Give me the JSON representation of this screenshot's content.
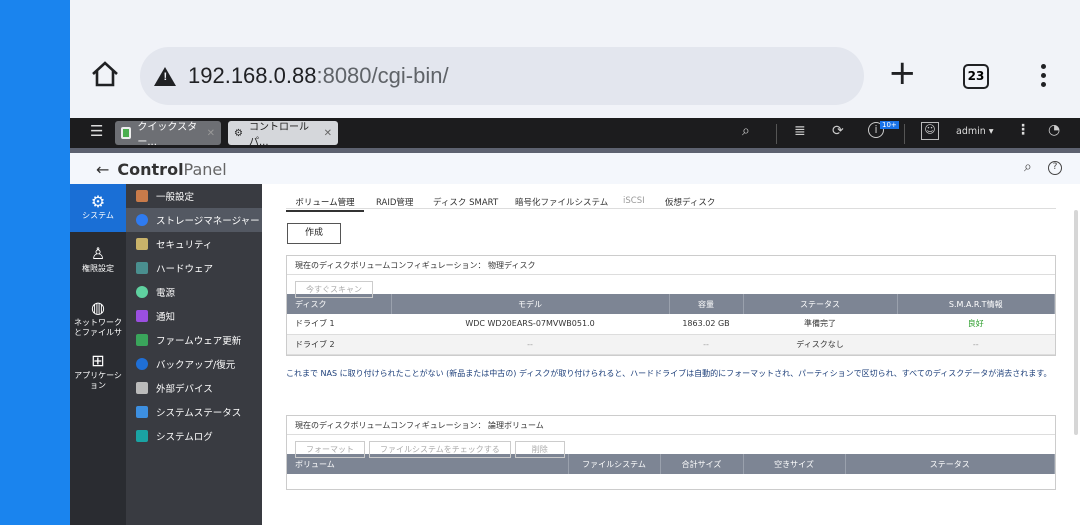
{
  "browser": {
    "url_host": "192.168.0.88",
    "url_rest": ":8080/cgi-bin/",
    "tab_count": "23",
    "new_tab": "+"
  },
  "nas_tabs": [
    {
      "label": "クイックスター..."
    },
    {
      "label": "コントロールパ..."
    }
  ],
  "topbar": {
    "notification_badge": "10+",
    "user": "admin ▾"
  },
  "header": {
    "title_bold": "Control",
    "title_light": "Panel"
  },
  "nav1": [
    {
      "label": "システム"
    },
    {
      "label": "権限設定"
    },
    {
      "label": "ネットワーク\nとファイルサ"
    },
    {
      "label": "アプリケーシ\nョン"
    }
  ],
  "nav2": [
    {
      "label": "一般設定",
      "color": "#c97b4a"
    },
    {
      "label": "ストレージマネージャー",
      "color": "#2f7bf0"
    },
    {
      "label": "セキュリティ",
      "color": "#c9b36a"
    },
    {
      "label": "ハードウェア",
      "color": "#4a8f8f"
    },
    {
      "label": "電源",
      "color": "#5fd1a0"
    },
    {
      "label": "通知",
      "color": "#9b4fe0"
    },
    {
      "label": "ファームウェア更新",
      "color": "#3aa55b"
    },
    {
      "label": "バックアップ/復元",
      "color": "#1f6fd6"
    },
    {
      "label": "外部デバイス",
      "color": "#bbbbbb"
    },
    {
      "label": "システムステータス",
      "color": "#3d8fe0"
    },
    {
      "label": "システムログ",
      "color": "#1aa3a3"
    }
  ],
  "tabs": [
    "ボリューム管理",
    "RAID管理",
    "ディスク SMART",
    "暗号化ファイルシステム",
    "iSCSI",
    "仮想ディスク"
  ],
  "create_label": "作成",
  "disk_panel": {
    "title": "現在のディスクボリュームコンフィギュレーション： 物理ディスク",
    "scan_label": "今すぐスキャン",
    "headers": [
      "ディスク",
      "モデル",
      "容量",
      "ステータス",
      "S.M.A.R.T情報"
    ],
    "rows": [
      [
        "ドライブ 1",
        "WDC WD20EARS-07MVWB051.0",
        "1863.02 GB",
        "準備完了",
        "良好"
      ],
      [
        "ドライブ 2",
        "--",
        "--",
        "ディスクなし",
        "--"
      ]
    ]
  },
  "note": "これまで NAS に取り付けられたことがない (新品または中古の) ディスクが取り付けられると、ハードドライブは自動的にフォーマットされ、パーティションで区切られ、すべてのディスクデータが消去されます。",
  "volume_panel": {
    "title": "現在のディスクボリュームコンフィギュレーション： 論理ボリューム",
    "buttons": [
      "フォーマット",
      "ファイルシステムをチェックする",
      "削除"
    ],
    "headers": [
      "ボリューム",
      "ファイルシステム",
      "合計サイズ",
      "空きサイズ",
      "ステータス"
    ]
  }
}
